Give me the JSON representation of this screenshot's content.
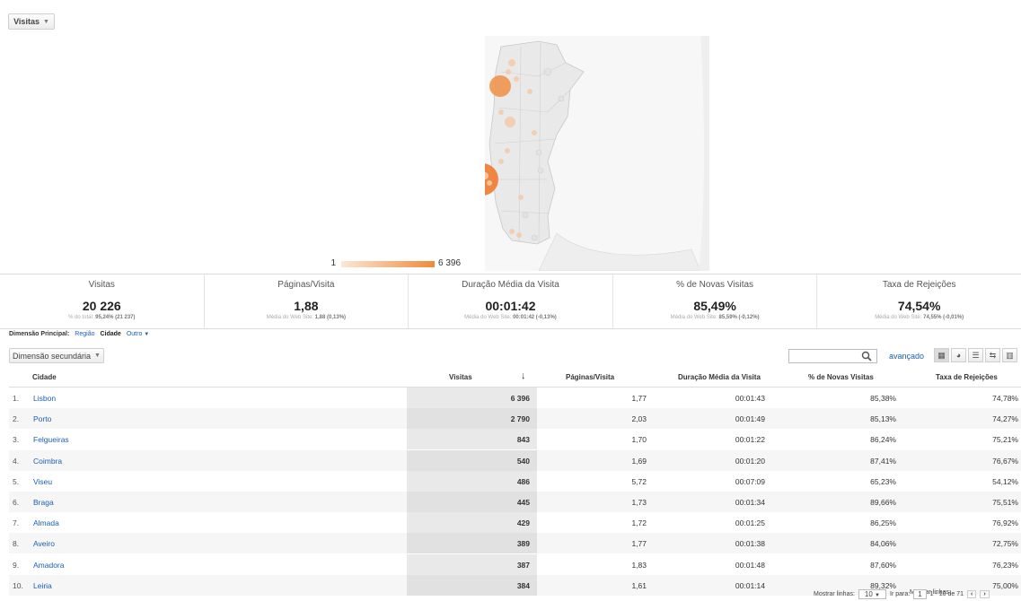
{
  "metric_selector": {
    "label": "Visitas"
  },
  "map_legend": {
    "min": "1",
    "max": "6 396"
  },
  "summary": [
    {
      "label": "Visitas",
      "value": "20 226",
      "sub_prefix": "% do total: ",
      "sub_value": "95,24% (21 237)"
    },
    {
      "label": "Páginas/Visita",
      "value": "1,88",
      "sub_prefix": "Média do Web Site: ",
      "sub_value": "1,88 (0,13%)"
    },
    {
      "label": "Duração Média da Visita",
      "value": "00:01:42",
      "sub_prefix": "Média do Web Site: ",
      "sub_value": "00:01:42 (-0,13%)"
    },
    {
      "label": "% de Novas Visitas",
      "value": "85,49%",
      "sub_prefix": "Média do Web Site: ",
      "sub_value": "85,59% (-0,12%)"
    },
    {
      "label": "Taxa de Rejeições",
      "value": "74,54%",
      "sub_prefix": "Média do Web Site: ",
      "sub_value": "74,55% (-0,01%)"
    }
  ],
  "dimension": {
    "label": "Dimensão Principal:",
    "options": [
      "Região",
      "Cidade",
      "Outro"
    ]
  },
  "secondary_dimension": {
    "label": "Dimensão secundária"
  },
  "search": {
    "advanced_label": "avançado"
  },
  "table": {
    "headers": {
      "city": "Cidade",
      "visits": "Visitas",
      "pages": "Páginas/Visita",
      "duration": "Duração Média da Visita",
      "new": "% de Novas Visitas",
      "bounce": "Taxa de Rejeições"
    },
    "rows": [
      {
        "num": "1.",
        "city": "Lisbon",
        "visits": "6 396",
        "pages": "1,77",
        "duration": "00:01:43",
        "new": "85,38%",
        "bounce": "74,78%"
      },
      {
        "num": "2.",
        "city": "Porto",
        "visits": "2 790",
        "pages": "2,03",
        "duration": "00:01:49",
        "new": "85,13%",
        "bounce": "74,27%"
      },
      {
        "num": "3.",
        "city": "Felgueiras",
        "visits": "843",
        "pages": "1,70",
        "duration": "00:01:22",
        "new": "86,24%",
        "bounce": "75,21%"
      },
      {
        "num": "4.",
        "city": "Coimbra",
        "visits": "540",
        "pages": "1,69",
        "duration": "00:01:20",
        "new": "87,41%",
        "bounce": "76,67%"
      },
      {
        "num": "5.",
        "city": "Viseu",
        "visits": "486",
        "pages": "5,72",
        "duration": "00:07:09",
        "new": "65,23%",
        "bounce": "54,12%"
      },
      {
        "num": "6.",
        "city": "Braga",
        "visits": "445",
        "pages": "1,73",
        "duration": "00:01:34",
        "new": "89,66%",
        "bounce": "75,51%"
      },
      {
        "num": "7.",
        "city": "Almada",
        "visits": "429",
        "pages": "1,72",
        "duration": "00:01:25",
        "new": "86,25%",
        "bounce": "76,92%"
      },
      {
        "num": "8.",
        "city": "Aveiro",
        "visits": "389",
        "pages": "1,77",
        "duration": "00:01:38",
        "new": "84,06%",
        "bounce": "72,75%"
      },
      {
        "num": "9.",
        "city": "Amadora",
        "visits": "387",
        "pages": "1,83",
        "duration": "00:01:48",
        "new": "87,60%",
        "bounce": "76,23%"
      },
      {
        "num": "10.",
        "city": "Leiria",
        "visits": "384",
        "pages": "1,61",
        "duration": "00:01:14",
        "new": "89,32%",
        "bounce": "75,00%"
      }
    ]
  },
  "footer": {
    "show_rows_label": "Mostrar linhas:",
    "show_rows_value": "10",
    "goto_label": "Ir para:",
    "goto_value": "1",
    "range": "1 - 10 de 71"
  }
}
